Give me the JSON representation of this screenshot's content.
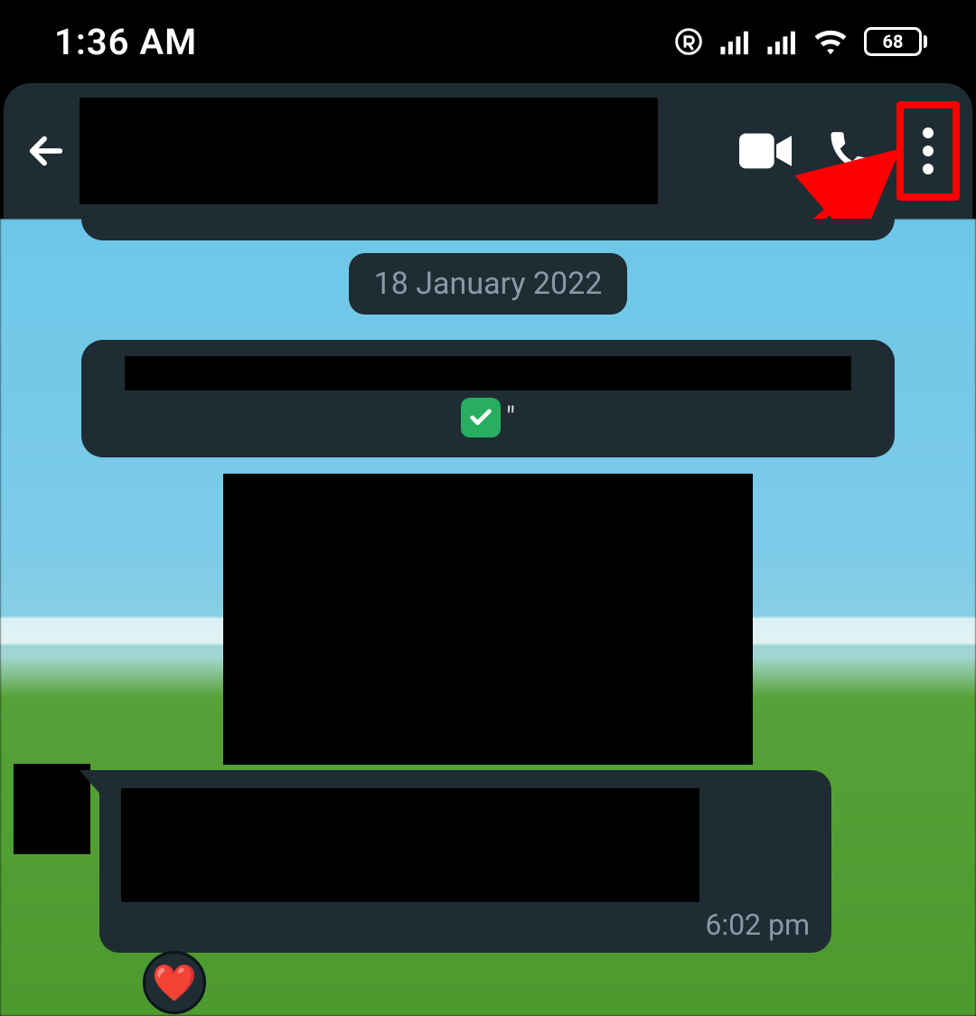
{
  "status": {
    "time": "1:36 AM",
    "battery": "68",
    "icons": [
      "registered",
      "signal1",
      "signal2",
      "wifi",
      "battery"
    ]
  },
  "header": {
    "contact_name_redacted": true,
    "buttons": {
      "back": "back",
      "video": "video-call",
      "voice": "voice-call",
      "more": "more-options"
    }
  },
  "chat": {
    "date_label": "18 January 2022",
    "encryption_suffix": "\"",
    "messages": [
      {
        "type": "incoming",
        "text_redacted": true,
        "time": "6:02 pm",
        "reaction": "❤️"
      }
    ]
  },
  "annotation": {
    "highlight_target": "more-options",
    "arrow_color": "#ff0000"
  }
}
